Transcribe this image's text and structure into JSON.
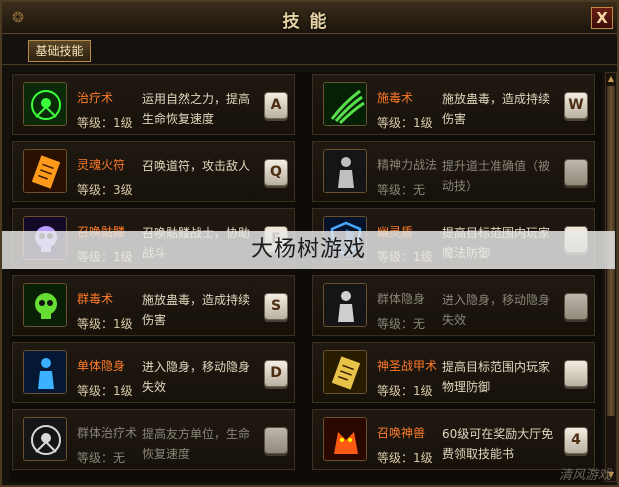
{
  "window": {
    "title": "技能",
    "close_label": "X"
  },
  "tabs": [
    {
      "label": "基础技能",
      "active": true
    }
  ],
  "skills": [
    {
      "name": "治疗术",
      "level": "等级：1级",
      "desc": "运用自然之力，提高生命恢复速度",
      "key": "A",
      "icon": "healing-icon",
      "locked": false
    },
    {
      "name": "施毒术",
      "level": "等级：1级",
      "desc": "施放蛊毒，造成持续伤害",
      "key": "W",
      "icon": "poison-icon",
      "locked": false
    },
    {
      "name": "灵魂火符",
      "level": "等级：3级",
      "desc": "召唤道符，攻击敌人",
      "key": "Q",
      "icon": "soul-talisman-icon",
      "locked": false
    },
    {
      "name": "精神力战法",
      "level": "等级：无",
      "desc": "提升道士准确值（被动技）",
      "key": "",
      "icon": "mental-power-icon",
      "locked": true
    },
    {
      "name": "召唤骷髅",
      "level": "等级：1级",
      "desc": "召唤骷髅战士，协助战斗",
      "key": "E",
      "icon": "skeleton-icon",
      "locked": false
    },
    {
      "name": "幽灵盾",
      "level": "等级：1级",
      "desc": "提高目标范围内玩家魔法防御",
      "key": "",
      "icon": "ghost-shield-icon",
      "locked": false
    },
    {
      "name": "群毒术",
      "level": "等级：1级",
      "desc": "施放蛊毒，造成持续伤害",
      "key": "S",
      "icon": "group-poison-icon",
      "locked": false
    },
    {
      "name": "群体隐身",
      "level": "等级：无",
      "desc": "进入隐身，移动隐身失效",
      "key": "",
      "icon": "group-stealth-icon",
      "locked": true
    },
    {
      "name": "单体隐身",
      "level": "等级：1级",
      "desc": "进入隐身，移动隐身失效",
      "key": "D",
      "icon": "stealth-icon",
      "locked": false
    },
    {
      "name": "神圣战甲术",
      "level": "等级：1级",
      "desc": "提高目标范围内玩家物理防御",
      "key": "",
      "icon": "holy-armor-icon",
      "locked": false
    },
    {
      "name": "群体治疗术",
      "level": "等级：无",
      "desc": "提高友方单位，生命恢复速度",
      "key": "",
      "icon": "group-heal-icon",
      "locked": true
    },
    {
      "name": "召唤神兽",
      "level": "等级：1级",
      "desc": "60级可在奖励大厅免费领取技能书",
      "key": "4",
      "icon": "divine-beast-icon",
      "locked": false
    }
  ],
  "colors": {
    "skill_name": "#ff7a2a",
    "locked_text": "#8a8578",
    "border": "#4a3a22"
  },
  "watermark": "大杨树游戏",
  "corner_logo": "清风游戏"
}
